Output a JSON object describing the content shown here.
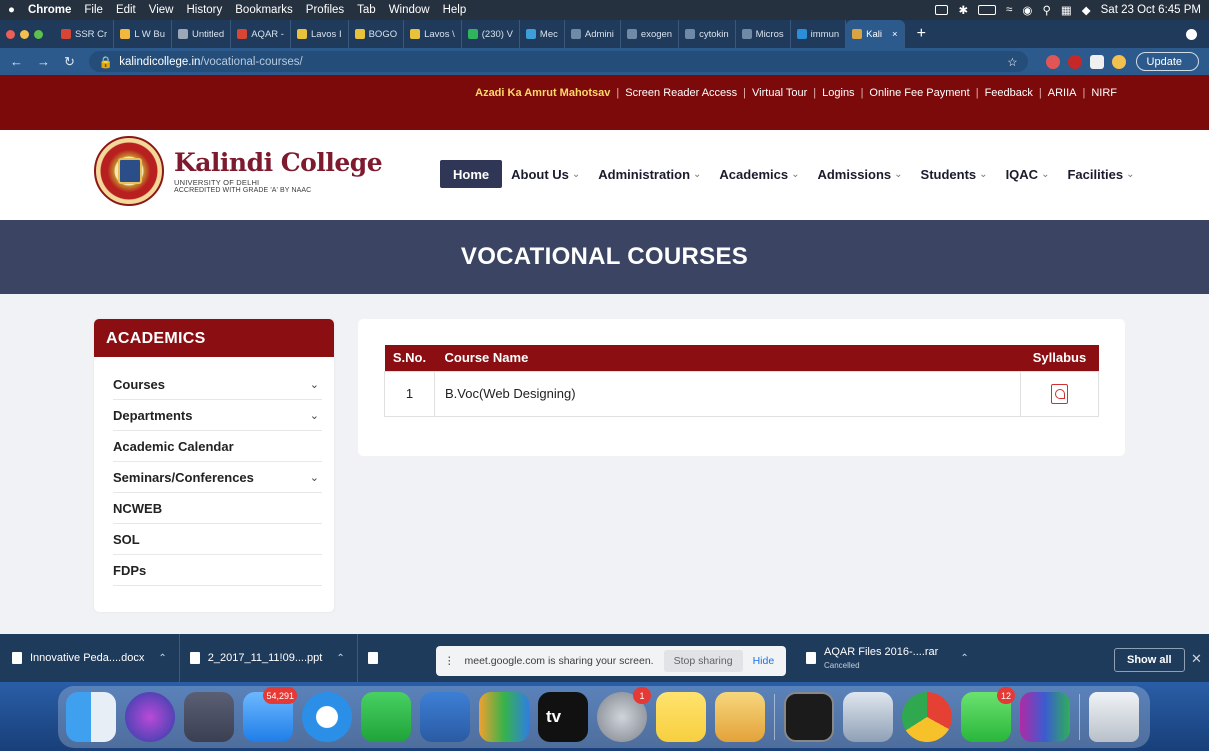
{
  "menubar": {
    "apple": "",
    "items": [
      "Chrome",
      "File",
      "Edit",
      "View",
      "History",
      "Bookmarks",
      "Profiles",
      "Tab",
      "Window",
      "Help"
    ],
    "datetime": "Sat 23 Oct 6:45 PM"
  },
  "tabs": [
    {
      "label": "SSR Cr",
      "color": "#d94535"
    },
    {
      "label": "L W Bu",
      "color": "#f2b83d"
    },
    {
      "label": "Untitled",
      "color": "#9aa8b8"
    },
    {
      "label": "AQAR -",
      "color": "#d94535"
    },
    {
      "label": "Lavos I",
      "color": "#e8c23a"
    },
    {
      "label": "BOGO",
      "color": "#e8c23a"
    },
    {
      "label": "Lavos \\",
      "color": "#e8c23a"
    },
    {
      "label": "(230) V",
      "color": "#2fb35c"
    },
    {
      "label": "Mec",
      "color": "#3c9fd8"
    },
    {
      "label": "Admini",
      "color": "#6f8aa6"
    },
    {
      "label": "exogen",
      "color": "#6f8aa6"
    },
    {
      "label": "cytokin",
      "color": "#6f8aa6"
    },
    {
      "label": "Micros",
      "color": "#6f8aa6"
    },
    {
      "label": "immun",
      "color": "#2b8ed8"
    },
    {
      "label": "Kali",
      "color": "#d9a441"
    }
  ],
  "address": {
    "domain": "kalindicollege.in",
    "path": "/vocational-courses/",
    "update_label": "Update"
  },
  "topnav": {
    "highlight": "Azadi Ka Amrut Mahotsav",
    "links": [
      "Screen Reader Access",
      "Virtual Tour",
      "Logins",
      "Online Fee Payment",
      "Feedback",
      "ARIIA",
      "NIRF"
    ]
  },
  "college": {
    "name": "Kalindi College",
    "sub1": "UNIVERSITY OF DELHI",
    "sub2": "ACCREDITED WITH GRADE 'A' BY NAAC"
  },
  "mainnav": {
    "home": "Home",
    "items": [
      "About Us",
      "Administration",
      "Academics",
      "Admissions",
      "Students",
      "IQAC",
      "Facilities"
    ]
  },
  "banner": {
    "title": "VOCATIONAL COURSES"
  },
  "sidebar": {
    "title": "ACADEMICS",
    "items": [
      {
        "label": "Courses",
        "has_children": true
      },
      {
        "label": "Departments",
        "has_children": true
      },
      {
        "label": "Academic Calendar",
        "has_children": false
      },
      {
        "label": "Seminars/Conferences",
        "has_children": true
      },
      {
        "label": "NCWEB",
        "has_children": false
      },
      {
        "label": "SOL",
        "has_children": false
      },
      {
        "label": "FDPs",
        "has_children": false
      }
    ]
  },
  "table": {
    "headers": [
      "S.No.",
      "Course Name",
      "Syllabus"
    ],
    "rows": [
      {
        "sno": "1",
        "name": "B.Voc(Web Designing)",
        "syllabus_icon": "pdf-icon"
      }
    ]
  },
  "downloads": {
    "items": [
      "Innovative Peda....docx",
      "2_2017_11_11!09....ppt"
    ],
    "share_text": "meet.google.com is sharing your screen.",
    "stop_label": "Stop sharing",
    "hide_label": "Hide",
    "last_file": "AQAR Files 2016-....rar",
    "last_status": "Cancelled",
    "show_all": "Show all"
  },
  "dock": {
    "badges": {
      "mail": "54,291",
      "settings": "1",
      "messages": "12"
    },
    "tv_label": "ðtv"
  },
  "colors": {
    "brand_red": "#8b0f12",
    "banner": "#3c4463",
    "nav_home": "#2f3656"
  }
}
